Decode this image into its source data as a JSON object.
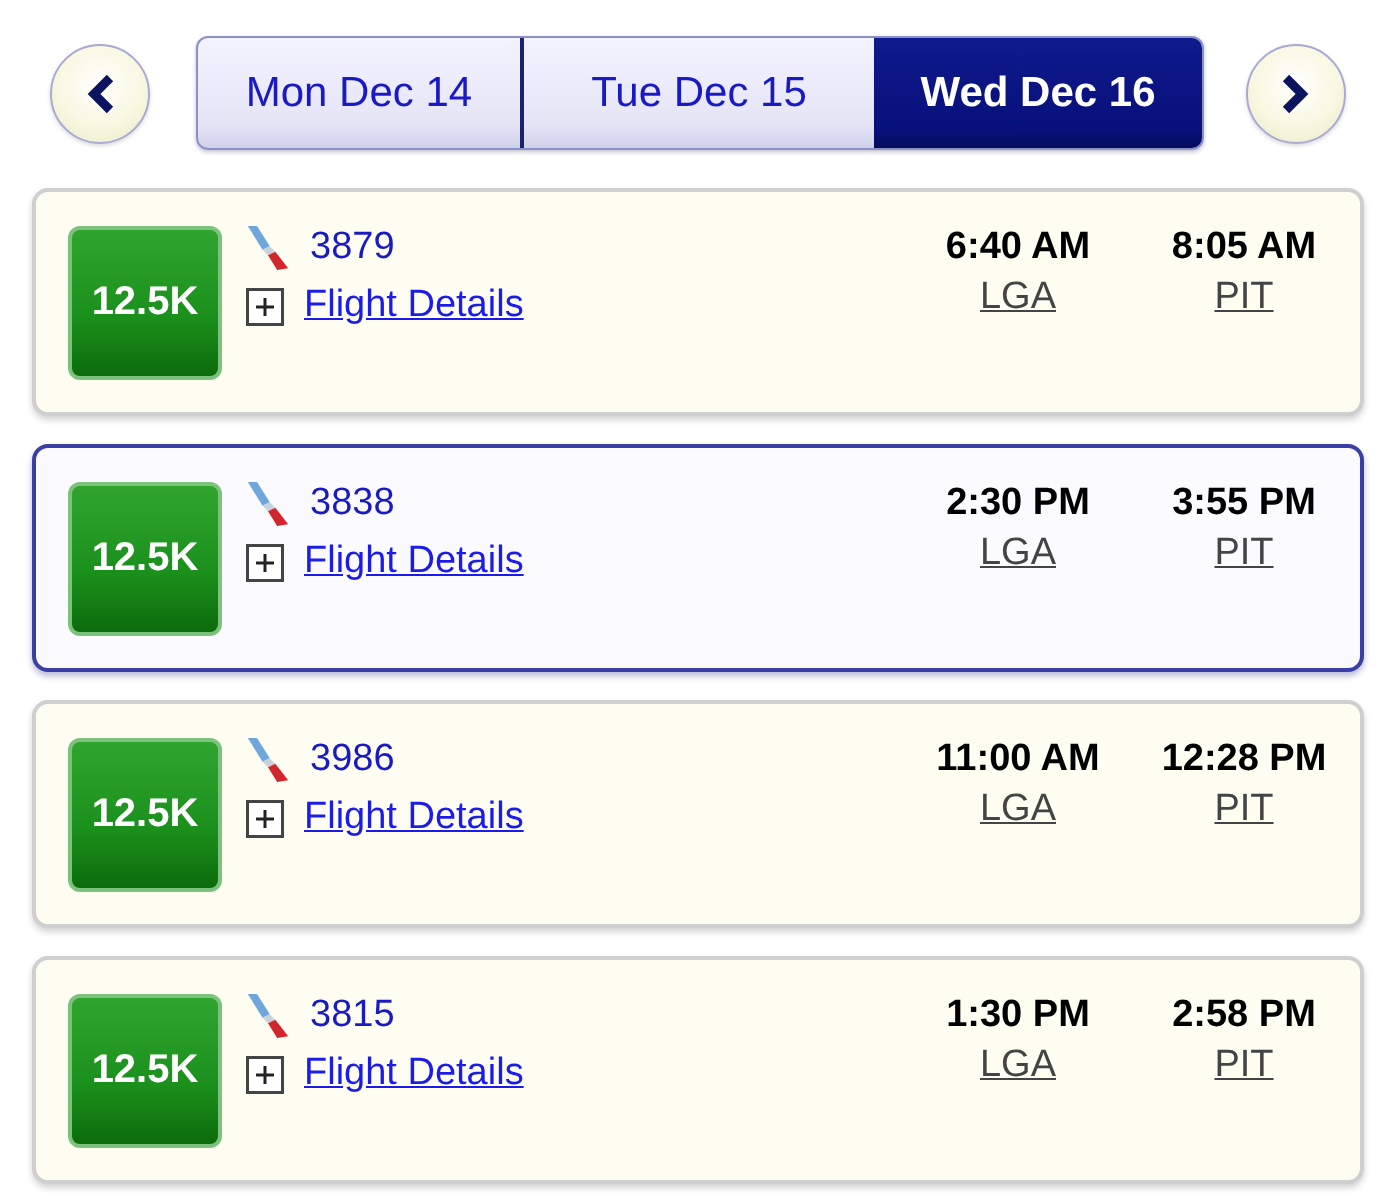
{
  "date_tabs": [
    {
      "label": "Mon Dec 14",
      "selected": false
    },
    {
      "label": "Tue Dec 15",
      "selected": false
    },
    {
      "label": "Wed Dec 16",
      "selected": true
    }
  ],
  "flights": [
    {
      "price": "12.5K",
      "flight_number": "3879",
      "details_link": "Flight Details",
      "departure_time": "6:40 AM",
      "departure_airport": "LGA",
      "arrival_time": "8:05 AM",
      "arrival_airport": "PIT",
      "selected": false
    },
    {
      "price": "12.5K",
      "flight_number": "3838",
      "details_link": "Flight Details",
      "departure_time": "2:30 PM",
      "departure_airport": "LGA",
      "arrival_time": "3:55 PM",
      "arrival_airport": "PIT",
      "selected": true
    },
    {
      "price": "12.5K",
      "flight_number": "3986",
      "details_link": "Flight Details",
      "departure_time": "11:00 AM",
      "departure_airport": "LGA",
      "arrival_time": "12:28 PM",
      "arrival_airport": "PIT",
      "selected": false
    },
    {
      "price": "12.5K",
      "flight_number": "3815",
      "details_link": "Flight Details",
      "departure_time": "1:30 PM",
      "departure_airport": "LGA",
      "arrival_time": "2:58 PM",
      "arrival_airport": "PIT",
      "selected": false
    }
  ]
}
